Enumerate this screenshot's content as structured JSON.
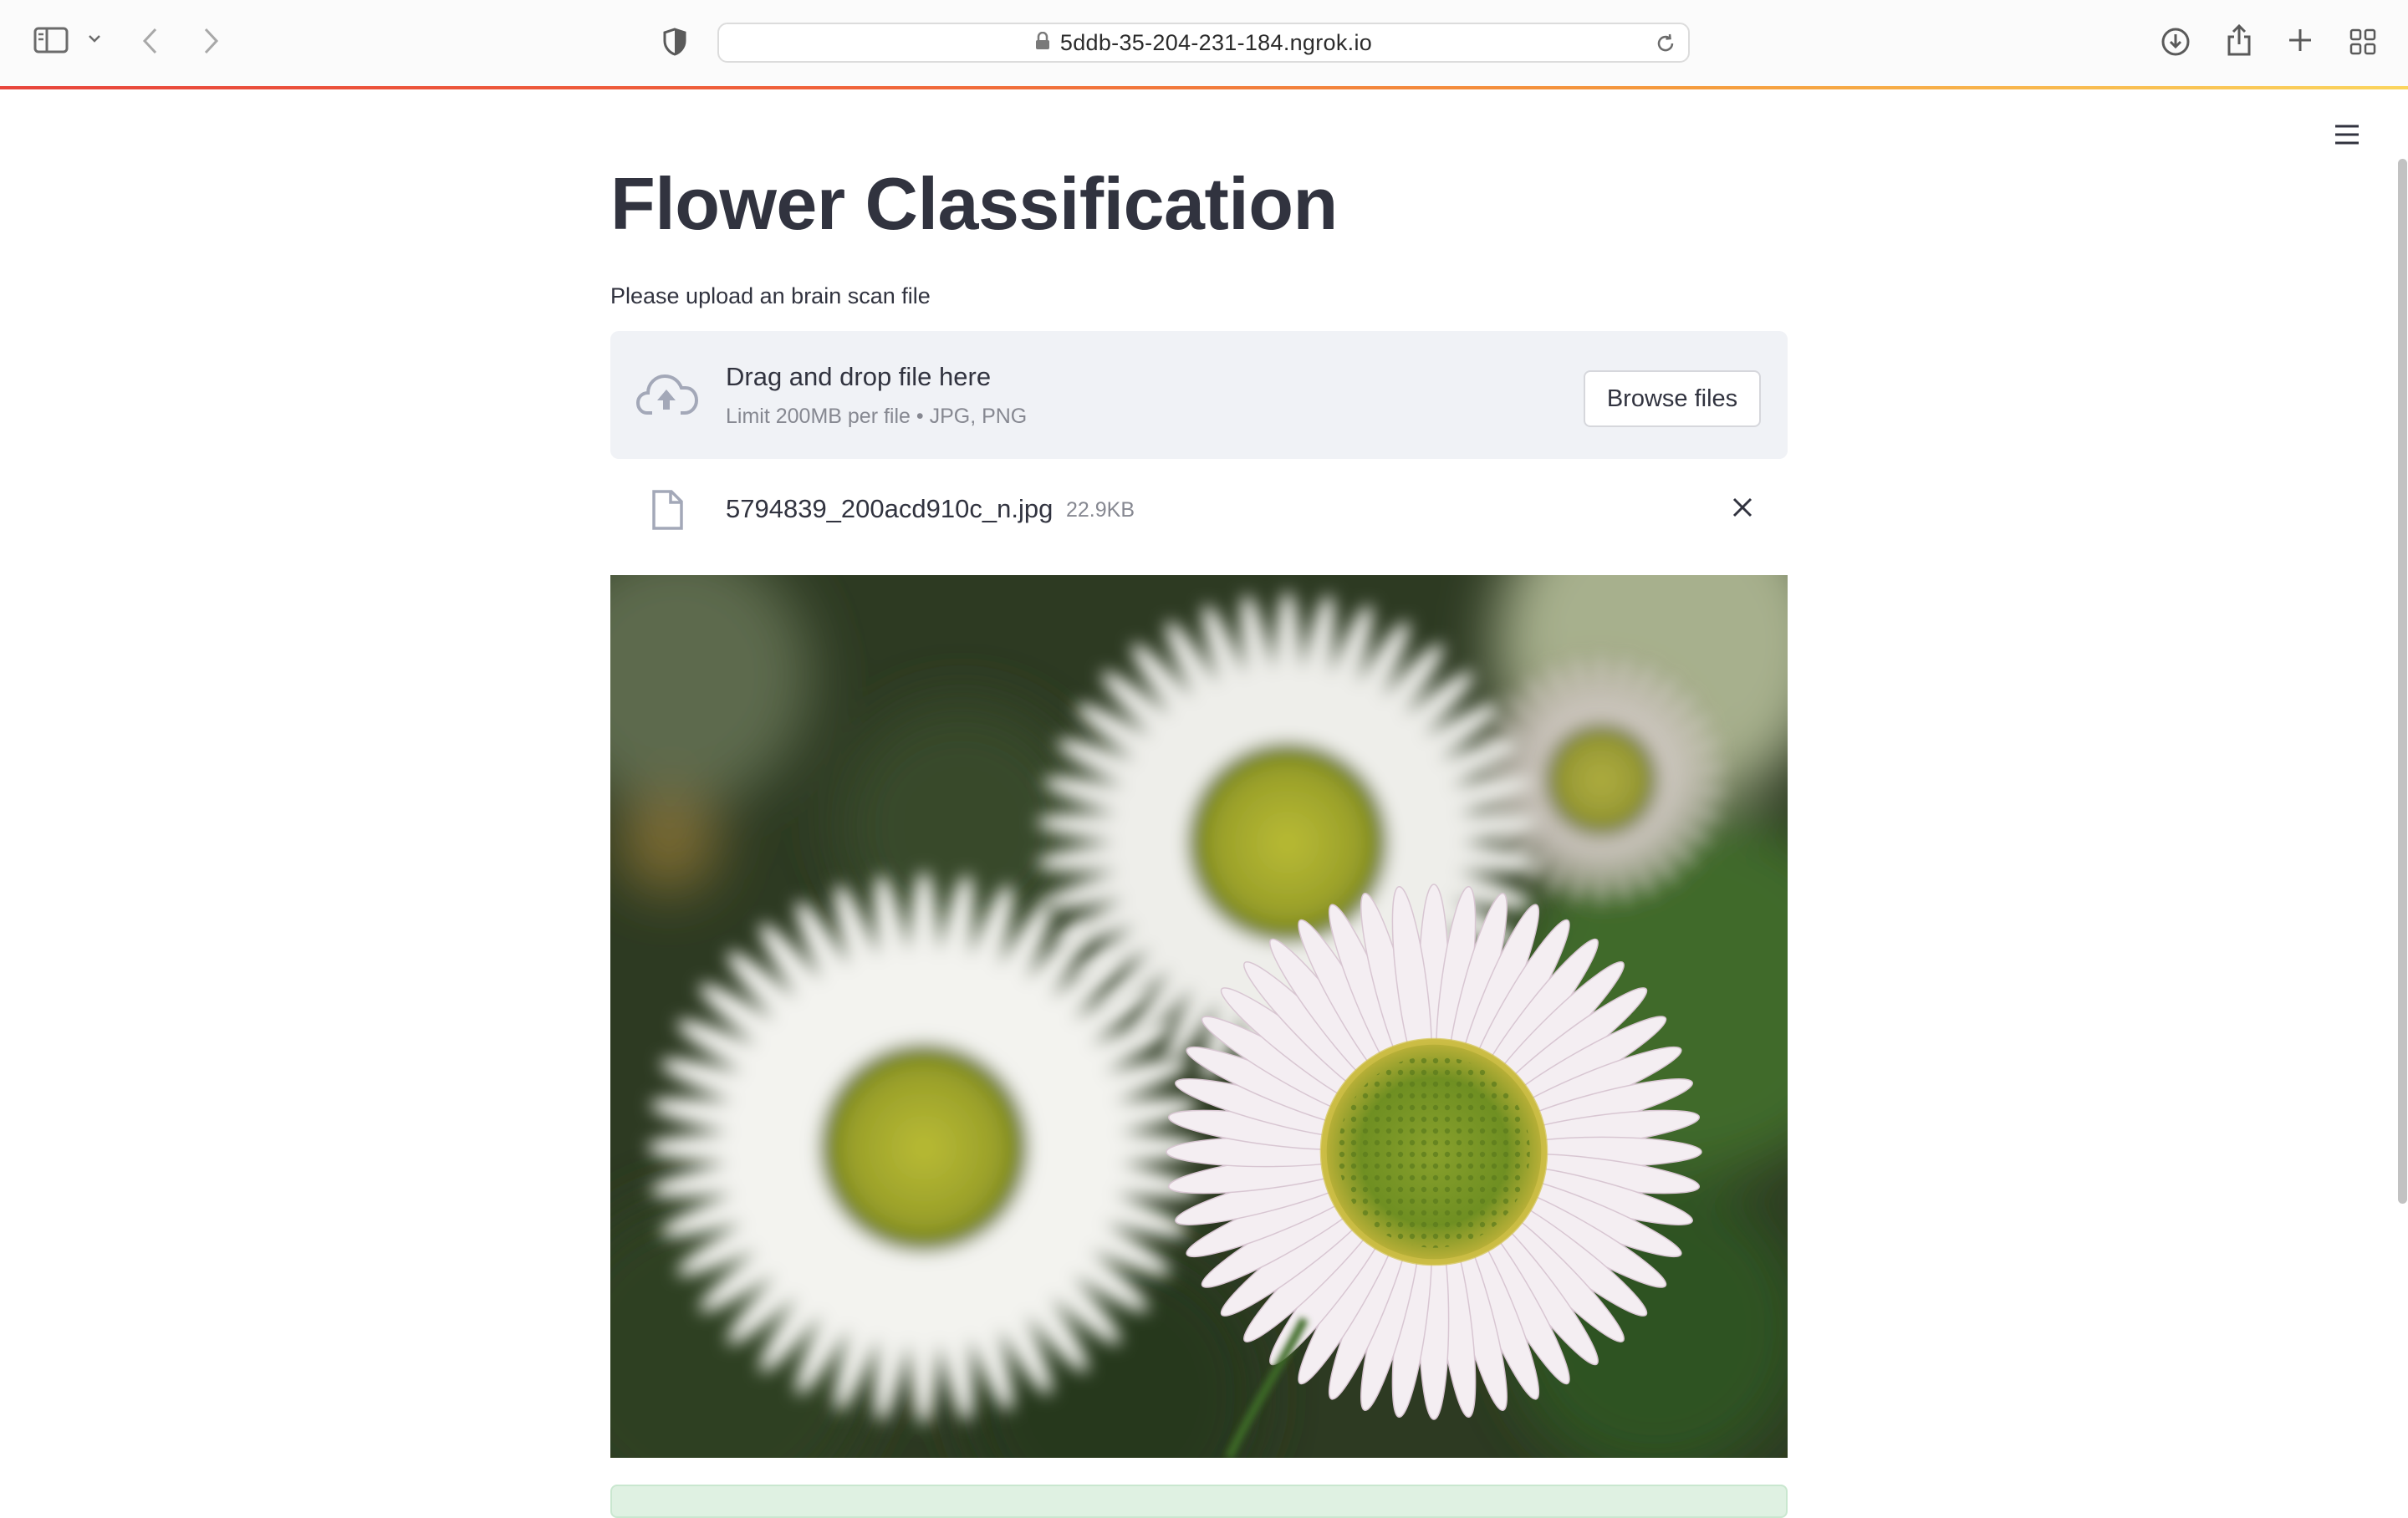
{
  "browser": {
    "url": "5ddb-35-204-231-184.ngrok.io",
    "icons": {
      "sidebar": "sidebar-toggle-icon",
      "tab_menu": "chevron-down-icon",
      "back": "chevron-left-icon",
      "forward": "chevron-right-icon",
      "privacy": "shield-icon",
      "lock": "lock-icon",
      "reload": "reload-icon",
      "downloads": "download-icon",
      "share": "share-icon",
      "new_tab": "plus-icon",
      "tab_overview": "grid-icon"
    },
    "progress_colors": [
      "#e8453b",
      "#f59b3d",
      "#fbd55e"
    ]
  },
  "app": {
    "title": "Flower Classification",
    "prompt": "Please upload an brain scan file",
    "uploader": {
      "drag_text": "Drag and drop file here",
      "limit_text": "Limit 200MB per file • JPG, PNG",
      "browse_label": "Browse files",
      "icon": "cloud-upload-icon"
    },
    "uploaded_file": {
      "name": "5794839_200acd910c_n.jpg",
      "size": "22.9KB",
      "icon": "file-icon",
      "remove_icon": "close-icon"
    },
    "image": {
      "subject": "daisies"
    },
    "menu_icon": "hamburger-icon",
    "colors": {
      "text": "#31333f",
      "muted": "#868891",
      "dropzone_bg": "#f0f2f6",
      "success_bg": "#dff1e2"
    }
  }
}
